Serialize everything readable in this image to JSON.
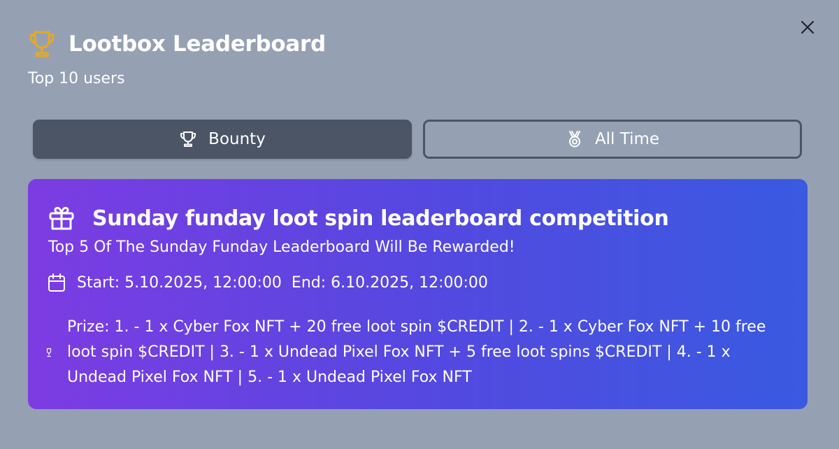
{
  "modal": {
    "title": "Lootbox Leaderboard",
    "subtitle": "Top 10 users",
    "close_icon": "close-icon"
  },
  "tabs": [
    {
      "label": "Bounty",
      "icon": "trophy-icon",
      "active": true
    },
    {
      "label": "All Time",
      "icon": "medal-icon",
      "active": false
    }
  ],
  "competition": {
    "title": "Sunday funday loot spin leaderboard competition",
    "subtitle": "Top 5 Of The Sunday Funday Leaderboard Will Be Rewarded!",
    "start": "Start: 5.10.2025, 12:00:00",
    "end": "End: 6.10.2025, 12:00:00",
    "prize": "Prize: 1. - 1 x Cyber Fox NFT + 20 free loot spin $CREDIT | 2. - 1 x Cyber Fox NFT + 10 free loot spin $CREDIT | 3. - 1 x Undead Pixel Fox NFT + 5 free loot spins $CREDIT |  4. - 1 x Undead Pixel Fox NFT | 5. - 1 x Undead Pixel Fox NFT"
  },
  "colors": {
    "background": "#95a0b3",
    "trophy_gold": "#e3a92b",
    "tab_active": "#4b5566",
    "card_gradient_start": "#7d3ce2",
    "card_gradient_end": "#395ae0"
  }
}
